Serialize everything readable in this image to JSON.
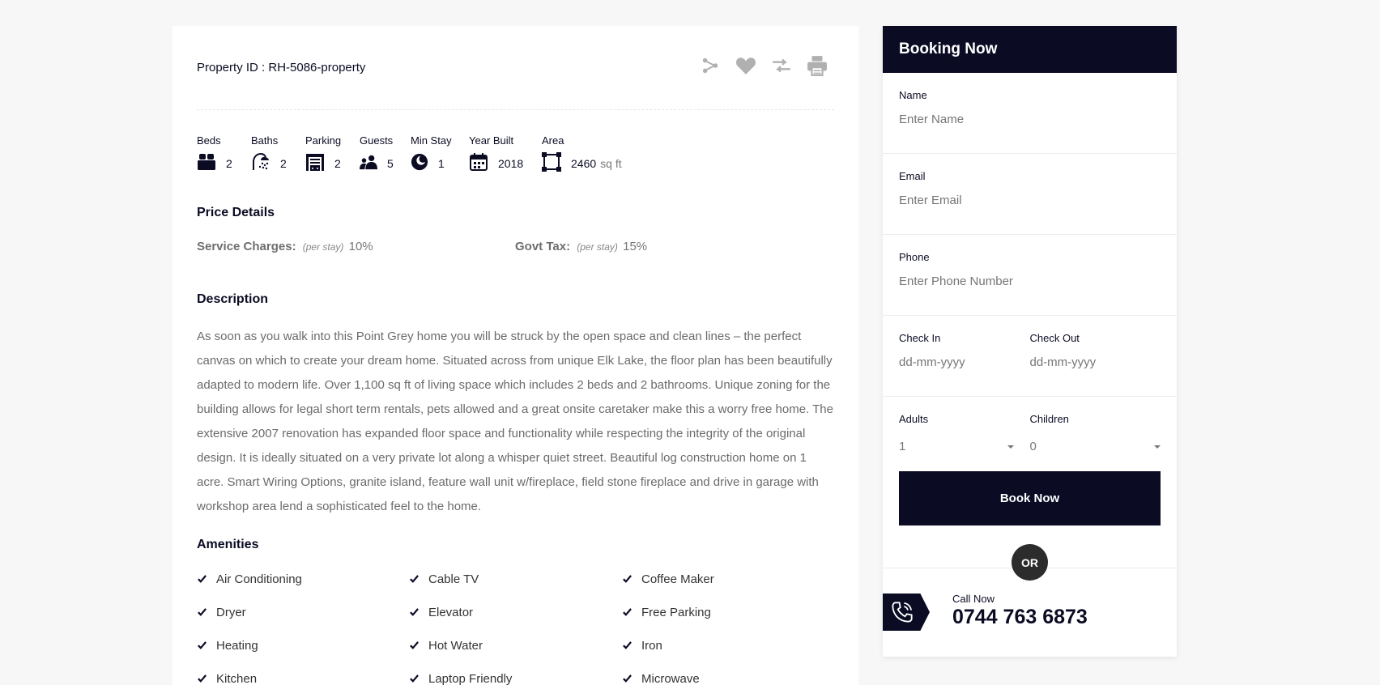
{
  "property": {
    "id_label": "Property ID : RH-5086-property"
  },
  "actions": [
    {
      "name": "share-icon"
    },
    {
      "name": "heart-icon"
    },
    {
      "name": "compare-icon"
    },
    {
      "name": "print-icon"
    }
  ],
  "features": [
    {
      "label": "Beds",
      "value": "2",
      "icon": "bed-icon"
    },
    {
      "label": "Baths",
      "value": "2",
      "icon": "shower-icon"
    },
    {
      "label": "Parking",
      "value": "2",
      "icon": "garage-icon"
    },
    {
      "label": "Guests",
      "value": "5",
      "icon": "guests-icon"
    },
    {
      "label": "Min Stay",
      "value": "1",
      "icon": "moon-icon"
    },
    {
      "label": "Year Built",
      "value": "2018",
      "icon": "calendar-icon"
    },
    {
      "label": "Area",
      "value": "2460",
      "unit": "sq ft",
      "icon": "area-icon"
    }
  ],
  "price": {
    "title": "Price Details",
    "service_label": "Service Charges:",
    "service_note": "(per stay)",
    "service_value": "10%",
    "tax_label": "Govt Tax:",
    "tax_note": "(per stay)",
    "tax_value": "15%"
  },
  "description": {
    "title": "Description",
    "text": "As soon as you walk into this Point Grey home you will be struck by the open space and clean lines – the perfect canvas on which to create your dream home. Situated across from unique Elk Lake, the floor plan has been beautifully adapted to modern life. Over 1,100 sq ft of living space which includes 2 beds and 2 bathrooms. Unique zoning for the building allows for legal short term rentals, pets allowed and a great onsite caretaker make this a worry free home. The extensive 2007 renovation has expanded floor space and functionality while respecting the integrity of the original design. It is ideally situated on a very private lot along a whisper quiet street. Beautiful log construction home on 1 acre. Smart Wiring Options, granite island, feature wall unit w/fireplace, field stone fireplace and drive in garage with workshop area lend a sophisticated feel to the home."
  },
  "amenities": {
    "title": "Amenities",
    "items": [
      "Air Conditioning",
      "Cable TV",
      "Coffee Maker",
      "Dryer",
      "Elevator",
      "Free Parking",
      "Heating",
      "Hot Water",
      "Iron",
      "Kitchen",
      "Laptop Friendly",
      "Microwave"
    ]
  },
  "booking": {
    "title": "Booking Now",
    "name_label": "Name",
    "name_placeholder": "Enter Name",
    "email_label": "Email",
    "email_placeholder": "Enter Email",
    "phone_label": "Phone",
    "phone_placeholder": "Enter Phone Number",
    "checkin_label": "Check In",
    "checkin_placeholder": "dd-mm-yyyy",
    "checkout_label": "Check Out",
    "checkout_placeholder": "dd-mm-yyyy",
    "adults_label": "Adults",
    "adults_value": "1",
    "children_label": "Children",
    "children_value": "0",
    "button": "Book Now",
    "or": "OR",
    "call_label": "Call Now",
    "call_number": "0744 763 6873"
  },
  "colors": {
    "primary": "#0b0c24",
    "background": "#f7f7f7",
    "muted": "#b0b0b0"
  }
}
